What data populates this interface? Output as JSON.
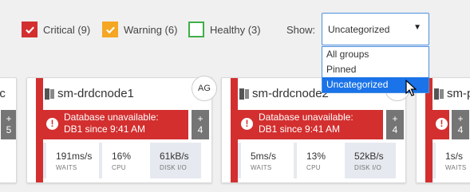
{
  "filters": {
    "critical": {
      "label": "Critical (9)",
      "checked": true,
      "color": "#d32f2f"
    },
    "warning": {
      "label": "Warning (6)",
      "checked": true,
      "color": "#f5a623"
    },
    "healthy": {
      "label": "Healthy (3)",
      "checked": false,
      "color": "#3fae49"
    }
  },
  "show": {
    "label": "Show:",
    "selected": "Uncategorized",
    "options": [
      "All groups",
      "Pinned",
      "Uncategorized"
    ]
  },
  "cards": [
    {
      "name": "sm-drdcnode1",
      "alert_line1": "Database unavailable:",
      "alert_line2": "DB1 since 9:41 AM",
      "plus": "+",
      "plus_count": "4",
      "waits": "191ms/s",
      "waits_label": "WAITS",
      "cpu": "16%",
      "cpu_label": "CPU",
      "disk": "61kB/s",
      "disk_label": "DISK I/O",
      "badge": "AG"
    },
    {
      "name": "sm-drdcnode2",
      "alert_line1": "Database unavailable:",
      "alert_line2": "DB1 since 9:41 AM",
      "plus": "+",
      "plus_count": "4",
      "waits": "5ms/s",
      "waits_label": "WAITS",
      "cpu": "13%",
      "cpu_label": "CPU",
      "disk": "52kB/s",
      "disk_label": "DISK I/O"
    }
  ],
  "partial_left": {
    "name_fragment": "oc",
    "plus": "+",
    "plus_count": "5"
  },
  "partial_right": {
    "name_fragment": "sm-p",
    "waits": "1s/s",
    "waits_label": "WAITS",
    "plus": "+",
    "plus_count": "4"
  }
}
